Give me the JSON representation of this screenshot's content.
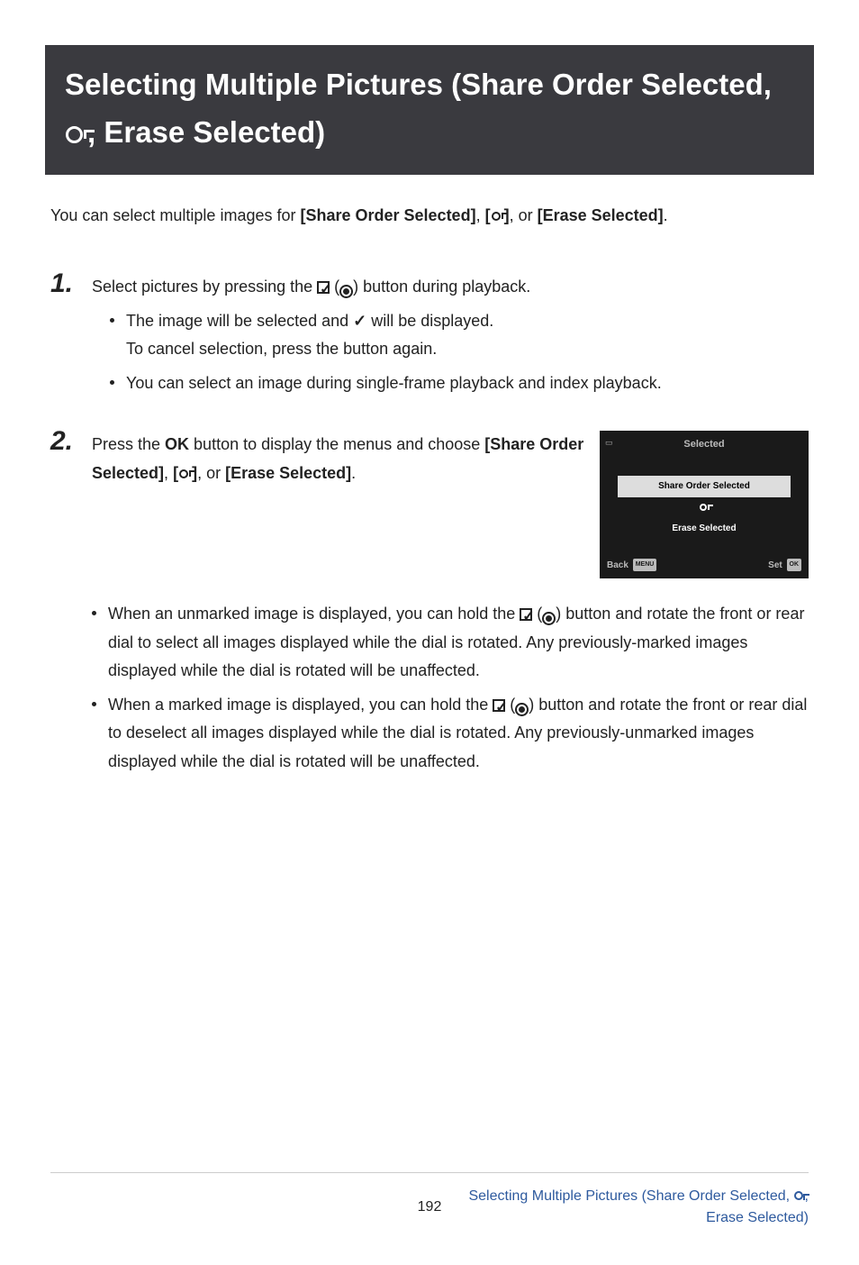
{
  "title": {
    "pre": "Selecting Multiple Pictures (Share Order Selected, ",
    "post": ", Erase Selected)"
  },
  "intro": {
    "pre": "You can select multiple images for ",
    "b1": "[Share Order Selected]",
    "mid1": ", ",
    "b2a": "[",
    "b2b": "]",
    "mid2": ", or ",
    "b3": "[Erase Selected]",
    "end": "."
  },
  "steps": {
    "s1": {
      "num": "1.",
      "t1": "Select pictures by pressing the ",
      "t2": " (",
      "t3": ") button during playback.",
      "b1a": "The image will be selected and ",
      "b1b": " will be displayed.",
      "b2": "To cancel selection, press the button again.",
      "b3": "You can select an image during single-frame playback and index playback."
    },
    "s2": {
      "num": "2.",
      "t1": "Press the ",
      "ok": "OK",
      "t2": " button to display the menus and choose ",
      "b1": "[Share Order Selected]",
      "mid1": ", ",
      "b2a": "[",
      "b2b": "]",
      "mid2": ", or ",
      "b3": "[Erase Selected]",
      "end": "."
    },
    "sub2": {
      "a1": "When an unmarked image is displayed, you can hold the ",
      "a2": " (",
      "a3": ") button and rotate the front or rear dial to select all images displayed while the dial is rotated. Any previously-marked images displayed while the dial is rotated will be unaffected.",
      "b1": "When a marked image is displayed, you can hold the ",
      "b2": " (",
      "b3": ") button and rotate the front or rear dial to deselect all images displayed while the dial is rotated. Any previously-unmarked images displayed while the dial is rotated will be unaffected."
    }
  },
  "shot": {
    "title": "Selected",
    "item1": "Share Order Selected",
    "item3": "Erase Selected",
    "back": "Back",
    "back_tag": "MENU",
    "set": "Set",
    "set_tag": "OK"
  },
  "footer": {
    "page": "192",
    "bc_pre": "Selecting Multiple Pictures (Share Order Selected, ",
    "bc_post": ", Erase Selected)"
  }
}
